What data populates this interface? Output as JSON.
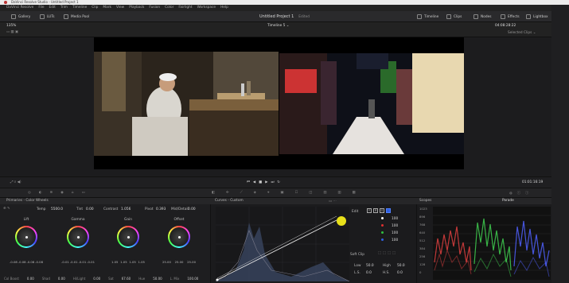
{
  "window": {
    "title": "DaVinci Resolve Studio - Untitled Project 1"
  },
  "menu": [
    "DaVinci Resolve",
    "File",
    "Edit",
    "Trim",
    "Timeline",
    "Clip",
    "Mark",
    "View",
    "Playback",
    "Fusion",
    "Color",
    "Fairlight",
    "Workspace",
    "Help"
  ],
  "toolbar": {
    "gallery": "Gallery",
    "luts": "LUTs",
    "media_pool": "Media Pool",
    "project": "Untitled Project 1",
    "edited": "Edited",
    "timeline": "Timeline",
    "clips": "Clips",
    "nodes": "Nodes",
    "effects": "Effects",
    "lightbox": "Lightbox"
  },
  "viewer": {
    "zoom": "135%",
    "timeline_name": "Timeline 5",
    "timecode": "04:08:28:22",
    "clip_mode": "Selected Clips"
  },
  "transport": {
    "timecode": "01:01:16:19"
  },
  "primaries": {
    "title": "Primaries - Color Wheels",
    "temp_label": "Temp",
    "temp": "5500.0",
    "tint_label": "Tint",
    "tint": "0.00",
    "contrast_label": "Contrast",
    "contrast": "1.056",
    "pivot_label": "Pivot",
    "pivot": "0.393",
    "middetail_label": "Mid/Detail",
    "middetail": "0.00",
    "wheels": [
      {
        "name": "Lift",
        "vals": [
          "-0.08",
          "-0.08",
          "-0.08",
          "-0.08"
        ]
      },
      {
        "name": "Gamma",
        "vals": [
          "-0.01",
          "-0.01",
          "-0.01",
          "-0.01"
        ]
      },
      {
        "name": "Gain",
        "vals": [
          "1.05",
          "1.05",
          "1.05",
          "1.05"
        ]
      },
      {
        "name": "Offset",
        "vals": [
          "25.00",
          "25.00",
          "25.00",
          ""
        ]
      }
    ],
    "bottom": {
      "colboost_label": "Col Boost",
      "colboost": "0.00",
      "shad_label": "Shad",
      "shad": "0.00",
      "hilight_label": "Hi/Light",
      "hilight": "0.00",
      "sat_label": "Sat",
      "sat": "67.60",
      "hue_label": "Hue",
      "hue": "50.00",
      "lmix_label": "L. Mix",
      "lmix": "100.00"
    }
  },
  "curves": {
    "title": "Curves - Custom",
    "edit": "Edit",
    "channels": [
      {
        "name": "white",
        "value": "100",
        "color": "#ffffff"
      },
      {
        "name": "red",
        "value": "100",
        "color": "#e03030"
      },
      {
        "name": "green",
        "value": "100",
        "color": "#30c040"
      },
      {
        "name": "blue",
        "value": "100",
        "color": "#3060e0"
      }
    ],
    "soft_clip": "Soft Clip",
    "low_label": "Low",
    "low": "50.0",
    "high_label": "High",
    "high": "50.0",
    "ls_label": "L.S.",
    "ls": "0.0",
    "hs_label": "H.S.",
    "hs": "0.0"
  },
  "scopes": {
    "title": "Scopes",
    "mode": "Parade",
    "ticks": [
      "1023",
      "896",
      "768",
      "640",
      "512",
      "384",
      "256",
      "128",
      "0"
    ]
  }
}
